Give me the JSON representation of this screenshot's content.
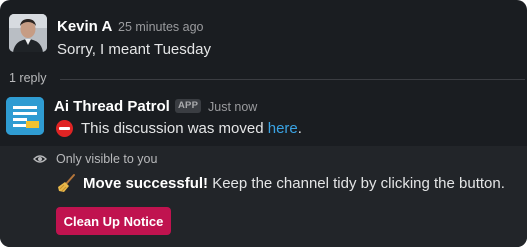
{
  "message_1": {
    "author": "Kevin A",
    "timestamp": "25 minutes ago",
    "text": "Sorry, I meant Tuesday"
  },
  "thread": {
    "reply_count": "1 reply"
  },
  "app_message": {
    "author": "Ai Thread Patrol",
    "badge": "APP",
    "timestamp": "Just now",
    "text_prefix": "This discussion was moved ",
    "link_text": "here",
    "text_suffix": ".",
    "icon": "no-entry-icon"
  },
  "ephemeral": {
    "visibility_note": "Only visible to you",
    "success_bold": "Move successful!",
    "success_rest": " Keep the channel tidy by clicking the button.",
    "icon": "broom-icon",
    "button_label": "Clean Up Notice",
    "button_color": "#c0134f"
  },
  "colors": {
    "background": "#1a1d21",
    "ephemeral_background": "#222529",
    "link": "#3aa3e3",
    "app_avatar": "#2f9cd2"
  }
}
